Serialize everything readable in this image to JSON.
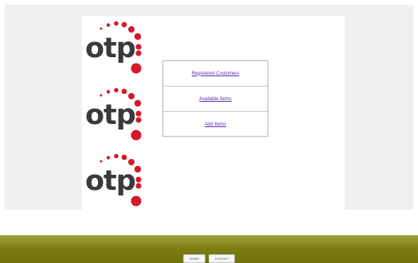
{
  "logos": [
    {
      "text": "otp"
    },
    {
      "text": "otp"
    },
    {
      "text": "otp"
    }
  ],
  "menu": {
    "items": [
      {
        "label": "Registered Customers"
      },
      {
        "label": "Available Items"
      },
      {
        "label": "Add Items"
      }
    ]
  },
  "footer": {
    "home_label": "HOME",
    "logout_label": "LOGOUT"
  },
  "colors": {
    "logo_dot": "#d5182a",
    "logo_text": "#3a3a3a",
    "link": "#5a2dbd",
    "footer_bar": "#7c7f12"
  },
  "icons": [
    "otp-logo"
  ]
}
